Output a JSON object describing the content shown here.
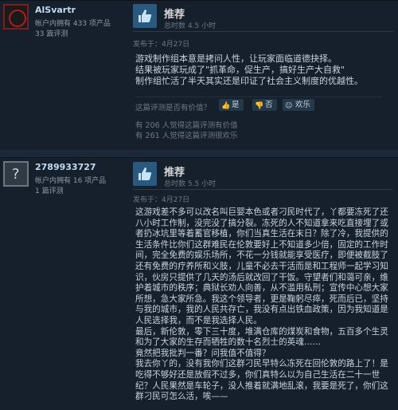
{
  "reviews": [
    {
      "username": "AlSvartr",
      "products_owned": "帐户内拥有 433 项产品",
      "review_count": "33 篇评测",
      "avatar_icon": "gun-icon",
      "verdict": "推荐",
      "hours": "总时数 4.5 小时",
      "posted": "发布于：4月27日",
      "lines": [
        "游戏制作组本意是拷问人性，让玩家面临道德抉择。",
        "结果被玩家玩成了\"抓革命，促生产，搞好生产大自救\"",
        "制作组忙活了半天其实还是印证了社会主义制度的优越性。"
      ],
      "helpful_question": "这篇评测是否有价值？",
      "yes_label": "是",
      "no_label": "否",
      "funny_label": "欢乐",
      "helpful_count": "有 206 人觉得这篇评测有价值",
      "funny_count": "有 261 人觉得这篇评测很欢乐"
    },
    {
      "username": "2789933727",
      "products_owned": "帐户内拥有 16 项产品",
      "review_count": "1 篇评测",
      "avatar_icon": "question-mark-icon",
      "verdict": "推荐",
      "hours": "总时数 5.5 小时",
      "posted": "发布于：4月27日",
      "lines": [
        "这游戏差不多可以改名叫巨婴本色或者刁民时代了，丫都要冻死了还",
        "八小时工作制，没完没了搞分裂。冻死的人不知道拿来吃直接埋了或",
        "者扔冰坑里等着蓄官移植，你们当真生活在末日？除了冷，我提供的",
        "生活条件比你们这群难民在伦敦要好上不知道多少倍，固定的工作时",
        "间，完全免费的娱乐场所，不花一分钱就能享受医疗，即便被截肢了",
        "还有免费的疗养所和义肢，儿童不必去干活而是和工程师一起学习知",
        "识，伙房只提供了几天的汤后就改回了干饭。守望者们和蔼可亲，维",
        "护着城市的秩序；典狱长劝人向善，从不滥用私刑；宣传中心想大家",
        "所想，急大家所急。我这个领导者，更是鞠躬尽瘁，死而后已，坚持",
        "与我的城市，我的人民共存亡，我没有点出铁血政策，因为我知道是",
        "人民选择我，而不是我选择人民。",
        "最后，新伦敦，零下三十度，堆满仓库的煤炭和食物，五百多个生灵",
        "和为了大家的生存而牺牲的数十名烈士的英魂……",
        "竟然把我批判一番？问我值不值得？",
        "我去你丫的，没有我你们这群刁民早特么冻死在回伦敦的路上了！是",
        "吃得不够好还是放假不过多，你们真特么以为自己生活在二十一世",
        "纪？人民果然是车轮子，没人推着就满地乱滚，我要是死了，你们这",
        "群刁民可怎么活，唉——"
      ]
    }
  ],
  "colors": {
    "background": "#1b2838",
    "card": "#16202d",
    "thumb_bg": "#2a5980",
    "username": "#c1dbf4"
  }
}
